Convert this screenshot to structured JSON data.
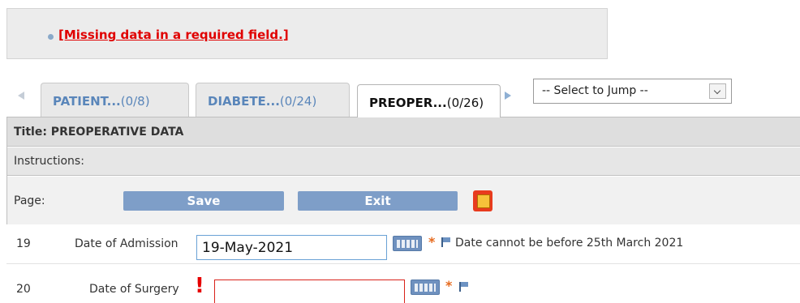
{
  "error": {
    "message": "[Missing data in a required field.]"
  },
  "tabs": [
    {
      "name": "PATIENT...",
      "count": "(0/8)",
      "active": false
    },
    {
      "name": "DIABETE...",
      "count": "(0/24)",
      "active": false
    },
    {
      "name": "PREOPER...",
      "count": "(0/26)",
      "active": true
    }
  ],
  "jump": {
    "selected": "-- Select to Jump --"
  },
  "form": {
    "title": "Title: PREOPERATIVE DATA",
    "instructions": "Instructions:",
    "page_label": "Page:",
    "save_label": "Save",
    "exit_label": "Exit"
  },
  "fields": [
    {
      "number": "19",
      "label": "Date of Admission",
      "value": "19-May-2021",
      "required": "*",
      "hint": "Date cannot be before 25th March 2021"
    },
    {
      "number": "20",
      "label": "Date of Surgery",
      "value": "",
      "required": "*",
      "error_mark": "!"
    }
  ],
  "colors": {
    "error": "#e00000",
    "tab_text": "#5a86ba",
    "button": "#7e9ec8",
    "required_star": "#e66a1e"
  },
  "icons": [
    "tab-prev-arrow-icon",
    "tab-next-arrow-icon",
    "chevron-down-icon",
    "pdf-icon",
    "calendar-icon",
    "flag-icon"
  ]
}
